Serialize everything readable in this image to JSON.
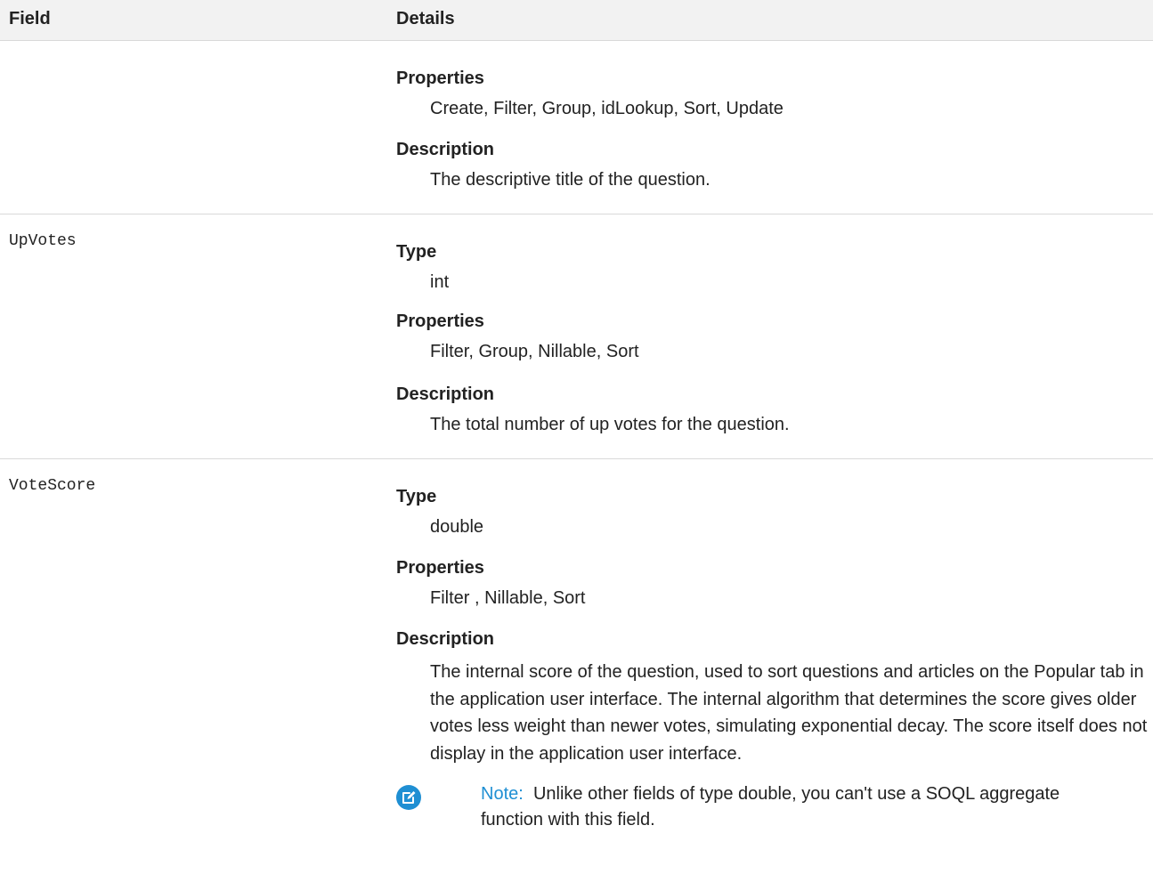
{
  "table": {
    "headers": {
      "field": "Field",
      "details": "Details"
    },
    "rows": [
      {
        "field": "",
        "sections": [
          {
            "term": "Properties",
            "value": "Create, Filter, Group, idLookup, Sort, Update"
          },
          {
            "term": "Description",
            "value": "The descriptive title of the question."
          }
        ]
      },
      {
        "field": "UpVotes",
        "sections": [
          {
            "term": "Type",
            "value": "int"
          },
          {
            "term": "Properties",
            "value": "Filter, Group, Nillable, Sort"
          },
          {
            "term": "Description",
            "value": "The total number of up votes for the question."
          }
        ]
      },
      {
        "field": "VoteScore",
        "sections": [
          {
            "term": "Type",
            "value": "double"
          },
          {
            "term": "Properties",
            "value": "Filter , Nillable, Sort"
          },
          {
            "term": "Description",
            "value": "The internal score of the question, used to sort questions and articles on the Popular tab in the application user interface. The internal algorithm that determines the score gives older votes less weight than newer votes, simulating exponential decay. The score itself does not display in the application user interface."
          }
        ],
        "note": {
          "label": "Note:",
          "text": "Unlike other fields of type double, you can't use a SOQL aggregate function with this field.",
          "icon": "edit-note-icon",
          "icon_color": "#1f8fd3"
        }
      }
    ]
  }
}
